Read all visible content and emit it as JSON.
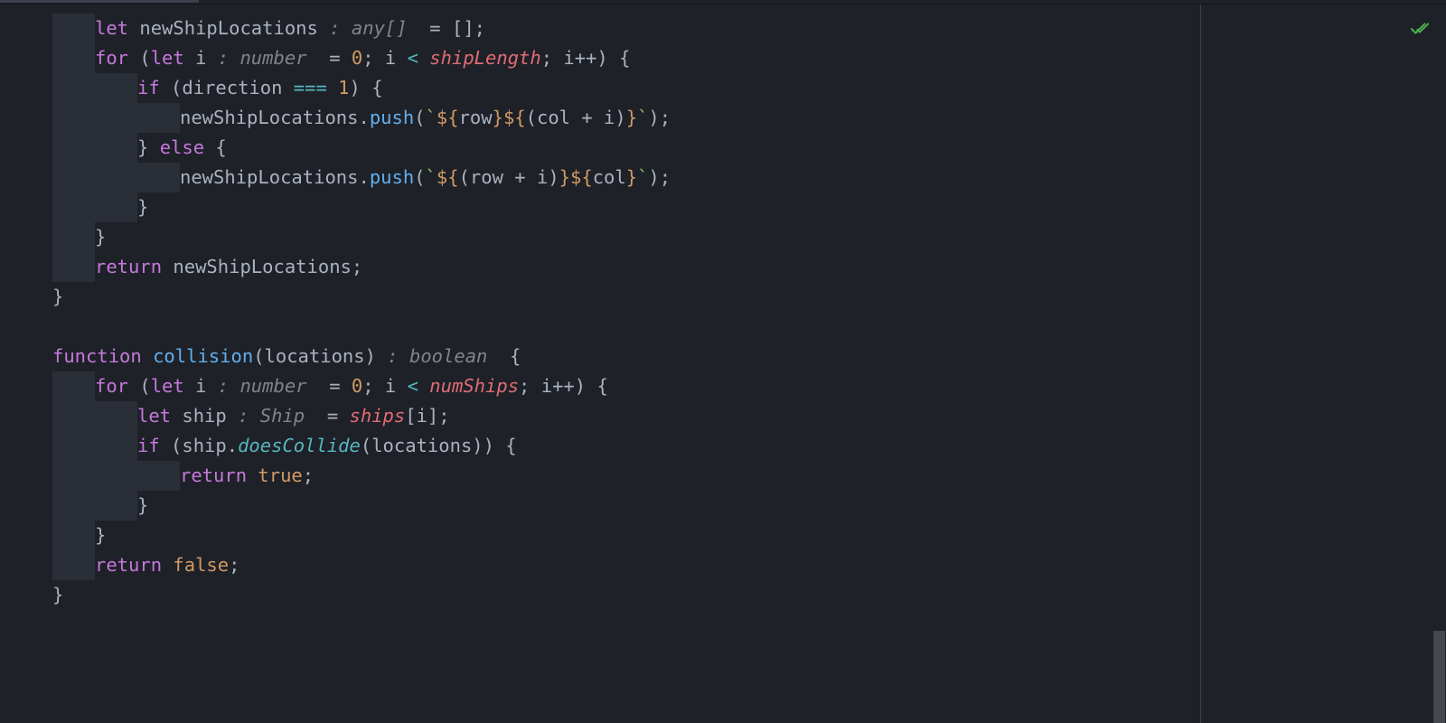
{
  "colors": {
    "background": "#1e2127",
    "indent_bg": "#2a2e37",
    "keyword": "#c678dd",
    "function": "#61afef",
    "variable": "#e06c75",
    "string": "#98c379",
    "number": "#d19a66",
    "operator": "#56b6c2",
    "type_hint": "#7f848e",
    "default": "#abb2bf",
    "check_ok": "#4caf50"
  },
  "status": {
    "ok_icon": "check-all-icon"
  },
  "code": {
    "line1": {
      "kw_let": "let",
      "name": "newShipLocations",
      "hint": " : any[] ",
      "eq": " = ",
      "br_open": "[",
      "br_close": "]",
      "semi": ";"
    },
    "line2": {
      "kw_for": "for",
      "paren": " (",
      "kw_let": "let",
      "var_i": " i",
      "hint": " : number ",
      "eq": " = ",
      "zero": "0",
      "semi1": "; ",
      "i2": "i ",
      "lt": "<",
      "shiplen": " shipLength",
      "semi2": "; ",
      "ipp": "i++) {"
    },
    "line3": {
      "kw_if": "if",
      "rest": " (direction ",
      "eqeq": "===",
      "sp": " ",
      "one": "1",
      "close": ") {"
    },
    "line4": {
      "obj": "newShipLocations.",
      "fn": "push",
      "open": "(",
      "bt1": "`",
      "d1": "${",
      "row": "row",
      "c1": "}",
      "d2": "${",
      "expr": "(col + i)",
      "c2": "}",
      "bt2": "`",
      "close": ");"
    },
    "line5": {
      "close": "} ",
      "kw_else": "else",
      "open": " {"
    },
    "line6": {
      "obj": "newShipLocations.",
      "fn": "push",
      "open": "(",
      "bt1": "`",
      "d1": "${",
      "expr": "(row + i)",
      "c1": "}",
      "d2": "${",
      "col": "col",
      "c2": "}",
      "bt2": "`",
      "close": ");"
    },
    "line7": {
      "brace": "}"
    },
    "line8": {
      "brace": "}"
    },
    "line9": {
      "kw_return": "return",
      "name": " newShipLocations;"
    },
    "line10": {
      "brace": "}"
    },
    "line12": {
      "kw_fn": "function",
      "sp": " ",
      "name": "collision",
      "args": "(locations)",
      "hint": " : boolean ",
      "open": " {"
    },
    "line13": {
      "kw_for": "for",
      "paren": " (",
      "kw_let": "let",
      "var_i": " i",
      "hint": " : number ",
      "eq": " = ",
      "zero": "0",
      "semi1": "; ",
      "i2": "i ",
      "lt": "<",
      "numships": " numShips",
      "semi2": "; ",
      "ipp": "i++) {"
    },
    "line14": {
      "kw_let": "let",
      "name": " ship",
      "hint": " : Ship ",
      "eq": " = ",
      "ships": "ships",
      "br": "[i];"
    },
    "line15": {
      "kw_if": "if",
      "open": " (ship.",
      "fn": "doesCollide",
      "args": "(locations)) {"
    },
    "line16": {
      "kw_return": "return",
      "sp": " ",
      "val": "true",
      "semi": ";"
    },
    "line17": {
      "brace": "}"
    },
    "line18": {
      "brace": "}"
    },
    "line19": {
      "kw_return": "return",
      "sp": " ",
      "val": "false",
      "semi": ";"
    },
    "line20": {
      "brace": "}"
    }
  }
}
